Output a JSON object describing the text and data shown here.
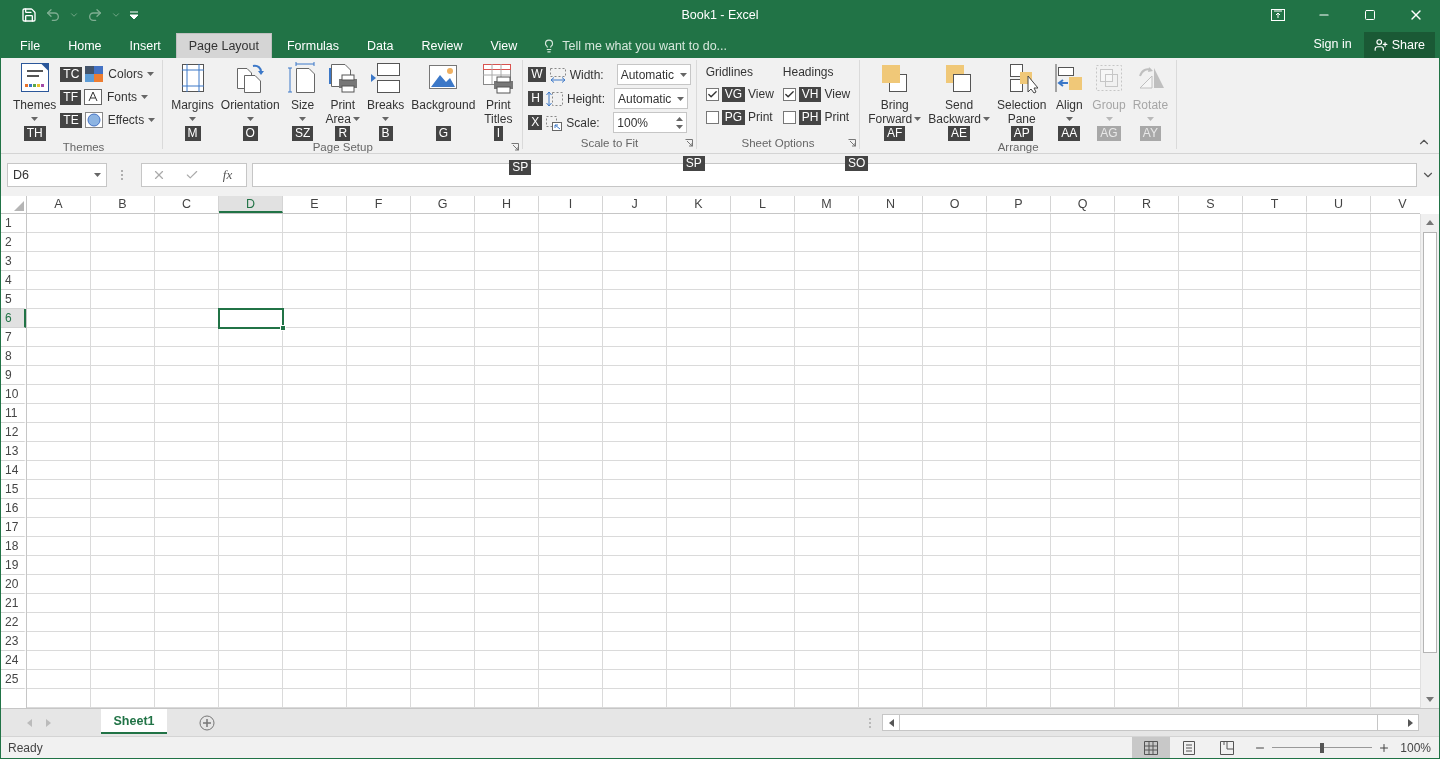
{
  "title_bar": {
    "title": "Book1 - Excel"
  },
  "tabs": [
    {
      "label": "File",
      "selected": false
    },
    {
      "label": "Home",
      "selected": false
    },
    {
      "label": "Insert",
      "selected": false
    },
    {
      "label": "Page Layout",
      "selected": true
    },
    {
      "label": "Formulas",
      "selected": false
    },
    {
      "label": "Data",
      "selected": false
    },
    {
      "label": "Review",
      "selected": false
    },
    {
      "label": "View",
      "selected": false
    }
  ],
  "tell_me": {
    "placeholder": "Tell me what you want to do..."
  },
  "account": {
    "sign_in": "Sign in",
    "share": "Share"
  },
  "ribbon": {
    "groups": [
      {
        "label": "Themes",
        "items": [
          {
            "kind": "large",
            "lines": [
              "Themes"
            ],
            "dropdown": true,
            "disabled": false,
            "keytip": "TH"
          },
          {
            "kind": "stack",
            "rows": [
              {
                "label": "Colors",
                "keytip": "TC"
              },
              {
                "label": "Fonts",
                "keytip": "TF"
              },
              {
                "label": "Effects",
                "keytip": "TE"
              }
            ]
          }
        ]
      },
      {
        "label": "Page Setup",
        "launcher_keytip": "SP",
        "items": [
          {
            "kind": "large",
            "lines": [
              "Margins"
            ],
            "dropdown": true,
            "disabled": false,
            "keytip": "M"
          },
          {
            "kind": "large",
            "lines": [
              "Orientation"
            ],
            "dropdown": true,
            "disabled": false,
            "keytip": "O"
          },
          {
            "kind": "large",
            "lines": [
              "Size"
            ],
            "dropdown": true,
            "disabled": false,
            "keytip": "SZ"
          },
          {
            "kind": "large",
            "lines": [
              "Print",
              "Area"
            ],
            "dropdown": true,
            "disabled": false,
            "keytip": "R"
          },
          {
            "kind": "large",
            "lines": [
              "Breaks"
            ],
            "dropdown": true,
            "disabled": false,
            "keytip": "B"
          },
          {
            "kind": "large",
            "lines": [
              "Background"
            ],
            "dropdown": false,
            "disabled": false,
            "keytip": "G"
          },
          {
            "kind": "large",
            "lines": [
              "Print",
              "Titles"
            ],
            "dropdown": false,
            "disabled": false,
            "keytip": "I"
          }
        ]
      },
      {
        "label": "Scale to Fit",
        "launcher_keytip": "SP",
        "items": [
          {
            "kind": "fields",
            "rows": [
              {
                "kind": "dropdown",
                "label": "Width:",
                "value": "Automatic",
                "keytip": "W"
              },
              {
                "kind": "dropdown",
                "label": "Height:",
                "value": "Automatic",
                "keytip": "H"
              },
              {
                "kind": "spinner",
                "label": "Scale:",
                "value": "100%",
                "keytip": "X"
              }
            ]
          }
        ]
      },
      {
        "label": "Sheet Options",
        "launcher_keytip": "SO",
        "items": [
          {
            "kind": "options",
            "heading": "Gridlines",
            "options": [
              {
                "label": "View",
                "checked": true,
                "keytip": "VG"
              },
              {
                "label": "Print",
                "checked": false,
                "keytip": "PG"
              }
            ]
          },
          {
            "kind": "options",
            "heading": "Headings",
            "options": [
              {
                "label": "View",
                "checked": true,
                "keytip": "VH"
              },
              {
                "label": "Print",
                "checked": false,
                "keytip": "PH"
              }
            ]
          }
        ]
      },
      {
        "label": "Arrange",
        "items": [
          {
            "kind": "large",
            "lines": [
              "Bring",
              "Forward"
            ],
            "dropdown": true,
            "disabled": false,
            "keytip": "AF"
          },
          {
            "kind": "large",
            "lines": [
              "Send",
              "Backward"
            ],
            "dropdown": true,
            "disabled": false,
            "keytip": "AE"
          },
          {
            "kind": "large",
            "lines": [
              "Selection",
              "Pane"
            ],
            "dropdown": false,
            "disabled": false,
            "keytip": "AP"
          },
          {
            "kind": "large",
            "lines": [
              "Align"
            ],
            "dropdown": true,
            "disabled": false,
            "keytip": "AA"
          },
          {
            "kind": "large",
            "lines": [
              "Group"
            ],
            "dropdown": true,
            "disabled": true,
            "keytip": "AG"
          },
          {
            "kind": "large",
            "lines": [
              "Rotate"
            ],
            "dropdown": true,
            "disabled": true,
            "keytip": "AY"
          }
        ]
      }
    ]
  },
  "formula_bar": {
    "name_box": "D6",
    "function_button": "fx"
  },
  "columns": [
    {
      "label": "A",
      "selected": false
    },
    {
      "label": "B",
      "selected": false
    },
    {
      "label": "C",
      "selected": false
    },
    {
      "label": "D",
      "selected": true
    },
    {
      "label": "E",
      "selected": false
    },
    {
      "label": "F",
      "selected": false
    },
    {
      "label": "G",
      "selected": false
    },
    {
      "label": "H",
      "selected": false
    },
    {
      "label": "I",
      "selected": false
    },
    {
      "label": "J",
      "selected": false
    },
    {
      "label": "K",
      "selected": false
    },
    {
      "label": "L",
      "selected": false
    },
    {
      "label": "M",
      "selected": false
    },
    {
      "label": "N",
      "selected": false
    },
    {
      "label": "O",
      "selected": false
    },
    {
      "label": "P",
      "selected": false
    },
    {
      "label": "Q",
      "selected": false
    },
    {
      "label": "R",
      "selected": false
    },
    {
      "label": "S",
      "selected": false
    },
    {
      "label": "T",
      "selected": false
    },
    {
      "label": "U",
      "selected": false
    },
    {
      "label": "V",
      "selected": false
    }
  ],
  "rows": [
    {
      "label": "1",
      "selected": false
    },
    {
      "label": "2",
      "selected": false
    },
    {
      "label": "3",
      "selected": false
    },
    {
      "label": "4",
      "selected": false
    },
    {
      "label": "5",
      "selected": false
    },
    {
      "label": "6",
      "selected": true
    },
    {
      "label": "7",
      "selected": false
    },
    {
      "label": "8",
      "selected": false
    },
    {
      "label": "9",
      "selected": false
    },
    {
      "label": "10",
      "selected": false
    },
    {
      "label": "11",
      "selected": false
    },
    {
      "label": "12",
      "selected": false
    },
    {
      "label": "13",
      "selected": false
    },
    {
      "label": "14",
      "selected": false
    },
    {
      "label": "15",
      "selected": false
    },
    {
      "label": "16",
      "selected": false
    },
    {
      "label": "17",
      "selected": false
    },
    {
      "label": "18",
      "selected": false
    },
    {
      "label": "19",
      "selected": false
    },
    {
      "label": "20",
      "selected": false
    },
    {
      "label": "21",
      "selected": false
    },
    {
      "label": "22",
      "selected": false
    },
    {
      "label": "23",
      "selected": false
    },
    {
      "label": "24",
      "selected": false
    },
    {
      "label": "25",
      "selected": false
    }
  ],
  "sheets": [
    {
      "label": "Sheet1",
      "selected": true
    }
  ],
  "status_bar": {
    "text": "Ready",
    "views": [
      {
        "selected": true
      },
      {
        "selected": false
      },
      {
        "selected": false
      }
    ],
    "zoom": {
      "level": 0.5,
      "reading": "100%"
    }
  }
}
